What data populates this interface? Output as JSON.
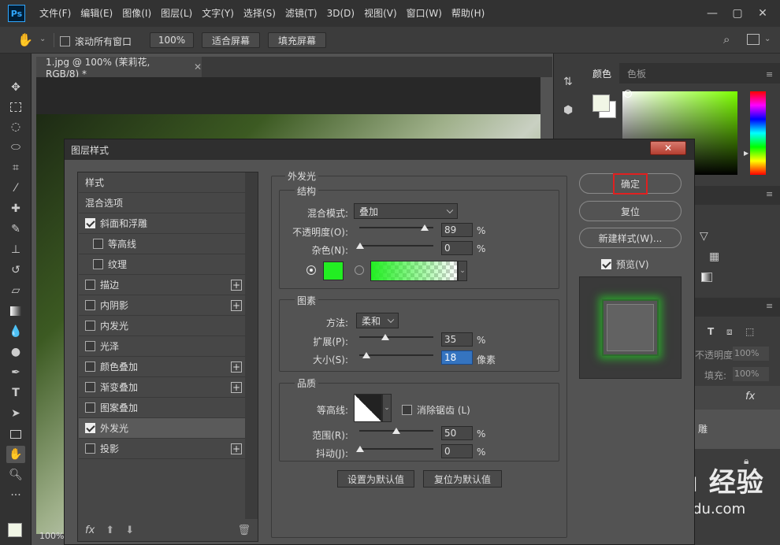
{
  "app": {
    "logo": "Ps"
  },
  "menu": [
    "文件(F)",
    "编辑(E)",
    "图像(I)",
    "图层(L)",
    "文字(Y)",
    "选择(S)",
    "滤镜(T)",
    "3D(D)",
    "视图(V)",
    "窗口(W)",
    "帮助(H)"
  ],
  "options_bar": {
    "scroll_all_label": "滚动所有窗口",
    "zoom_value": "100%",
    "fit_screen_label": "适合屏幕",
    "fill_screen_label": "填充屏幕"
  },
  "document": {
    "tab_title": "1.jpg @ 100% (茉莉花, RGB/8) *",
    "zoom_readout": "100%"
  },
  "right_panel": {
    "tabs": [
      "颜色",
      "色板"
    ],
    "opacity_label": "不透明度:",
    "opacity_value": "100%",
    "fill_label": "填充:",
    "fill_value": "100%",
    "fx_label": "fx",
    "layer_fragment": "雕"
  },
  "dialog": {
    "title": "图层样式",
    "close_label": "✕",
    "styles": [
      {
        "label": "样式",
        "checkbox": false,
        "checked": false,
        "plus": false
      },
      {
        "label": "混合选项",
        "checkbox": false,
        "checked": false,
        "plus": false
      },
      {
        "label": "斜面和浮雕",
        "checkbox": true,
        "checked": true,
        "plus": false
      },
      {
        "label": "等高线",
        "checkbox": true,
        "checked": false,
        "plus": false
      },
      {
        "label": "纹理",
        "checkbox": true,
        "checked": false,
        "plus": false
      },
      {
        "label": "描边",
        "checkbox": true,
        "checked": false,
        "plus": true
      },
      {
        "label": "内阴影",
        "checkbox": true,
        "checked": false,
        "plus": true
      },
      {
        "label": "内发光",
        "checkbox": true,
        "checked": false,
        "plus": false
      },
      {
        "label": "光泽",
        "checkbox": true,
        "checked": false,
        "plus": false
      },
      {
        "label": "颜色叠加",
        "checkbox": true,
        "checked": false,
        "plus": true
      },
      {
        "label": "渐变叠加",
        "checkbox": true,
        "checked": false,
        "plus": true
      },
      {
        "label": "图案叠加",
        "checkbox": true,
        "checked": false,
        "plus": false
      },
      {
        "label": "外发光",
        "checkbox": true,
        "checked": true,
        "plus": false,
        "selected": true
      },
      {
        "label": "投影",
        "checkbox": true,
        "checked": false,
        "plus": true
      }
    ],
    "footer_fx": "fx",
    "section_title": "外发光",
    "structure": {
      "title": "结构",
      "blend_label": "混合模式:",
      "blend_value": "叠加",
      "opacity_label": "不透明度(O):",
      "opacity_value": "89",
      "opacity_unit": "%",
      "noise_label": "杂色(N):",
      "noise_value": "0",
      "noise_unit": "%",
      "glow_color": "#22ee22"
    },
    "elements": {
      "title": "图素",
      "method_label": "方法:",
      "method_value": "柔和",
      "spread_label": "扩展(P):",
      "spread_value": "35",
      "spread_unit": "%",
      "size_label": "大小(S):",
      "size_value": "18",
      "size_unit": "像素"
    },
    "quality": {
      "title": "品质",
      "contour_label": "等高线:",
      "antialias_label": "消除锯齿 (L)",
      "range_label": "范围(R):",
      "range_value": "50",
      "range_unit": "%",
      "jitter_label": "抖动(J):",
      "jitter_value": "0",
      "jitter_unit": "%"
    },
    "set_default_label": "设置为默认值",
    "reset_default_label": "复位为默认值",
    "ok_label": "确定",
    "reset_label": "复位",
    "new_style_label": "新建样式(W)...",
    "preview_label": "预览(V)",
    "highlight_color": "#e02020"
  },
  "watermark": {
    "brand": "Bai du 经验",
    "url": "jingyan.baidu.com"
  }
}
